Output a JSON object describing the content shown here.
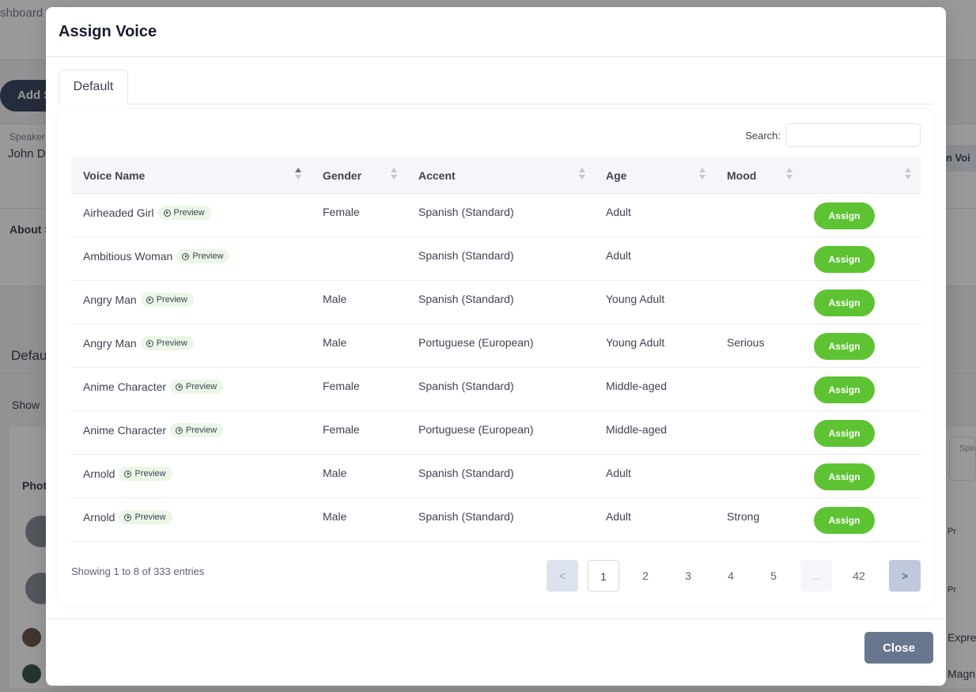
{
  "background": {
    "breadcrumb": "shboard",
    "add_button": "Add S",
    "speaker_label": "Speaker",
    "speaker_value": "John Do",
    "assign_voice_button": "gn Voi",
    "about_label": "About S",
    "tab_default": "Defau",
    "show_label": "Show",
    "photo_header": "Phot",
    "speaker_col": "Spea",
    "right_texts": [
      "Pr",
      "Pr",
      "Expre",
      "Magn"
    ]
  },
  "modal": {
    "title": "Assign Voice",
    "tabs": [
      {
        "label": "Default"
      }
    ],
    "search": {
      "label": "Search:",
      "value": "",
      "placeholder": ""
    },
    "columns": [
      {
        "label": "Voice Name"
      },
      {
        "label": "Gender"
      },
      {
        "label": "Accent"
      },
      {
        "label": "Age"
      },
      {
        "label": "Mood"
      },
      {
        "label": ""
      }
    ],
    "preview_label": "Preview",
    "assign_label": "Assign",
    "rows": [
      {
        "name": "Airheaded Girl",
        "gender": "Female",
        "accent": "Spanish (Standard)",
        "age": "Adult",
        "mood": ""
      },
      {
        "name": "Ambitious Woman",
        "gender": "",
        "accent": "Spanish (Standard)",
        "age": "Adult",
        "mood": ""
      },
      {
        "name": "Angry Man",
        "gender": "Male",
        "accent": "Spanish (Standard)",
        "age": "Young Adult",
        "mood": ""
      },
      {
        "name": "Angry Man",
        "gender": "Male",
        "accent": "Portuguese (European)",
        "age": "Young Adult",
        "mood": "Serious"
      },
      {
        "name": "Anime Character",
        "gender": "Female",
        "accent": "Spanish (Standard)",
        "age": "Middle-aged",
        "mood": ""
      },
      {
        "name": "Anime Character",
        "gender": "Female",
        "accent": "Portuguese (European)",
        "age": "Middle-aged",
        "mood": ""
      },
      {
        "name": "Arnold",
        "gender": "Male",
        "accent": "Spanish (Standard)",
        "age": "Adult",
        "mood": ""
      },
      {
        "name": "Arnold",
        "gender": "Male",
        "accent": "Spanish (Standard)",
        "age": "Adult",
        "mood": "Strong"
      }
    ],
    "info": "Showing 1 to 8 of 333 entries",
    "pagination": {
      "prev": "<",
      "pages": [
        "1",
        "2",
        "3",
        "4",
        "5",
        "...",
        "42"
      ],
      "current": "1",
      "next": ">"
    },
    "close_label": "Close"
  },
  "colors": {
    "assign_green": "#5ec332",
    "preview_bg": "#ebf7e6",
    "close_btn": "#68768f",
    "overlay": "rgba(0,0,0,0.4)"
  }
}
